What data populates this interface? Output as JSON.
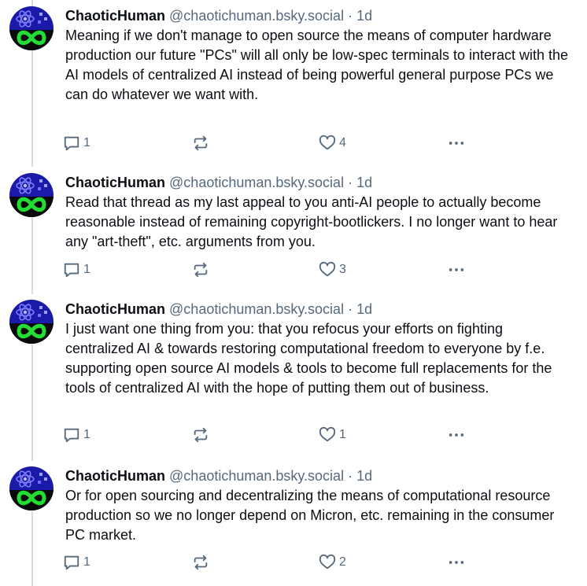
{
  "theme": {
    "text": "#0b0f14",
    "muted": "#56697c",
    "thread_line": "#d4dbe2",
    "avatar_bg": "#1a1aa8",
    "avatar_accent": "#22dd33"
  },
  "posts": [
    {
      "author": "ChaoticHuman",
      "handle": "@chaotichuman.bsky.social",
      "separator": "·",
      "time": "1d",
      "text": "Meaning if we don't manage to open source the means of computer hardware production our future \"PCs\" will all only be low-spec terminals to interact with the AI models of centralized AI instead of being powerful general purpose PCs we can do whatever we want with.",
      "replies": "1",
      "reposts": "",
      "likes": "4",
      "icons": [
        "reply-icon",
        "repost-icon",
        "heart-icon",
        "more-icon"
      ]
    },
    {
      "author": "ChaoticHuman",
      "handle": "@chaotichuman.bsky.social",
      "separator": "·",
      "time": "1d",
      "text": "Read that thread as my last appeal to you anti-AI people to actually become reasonable instead of remaining copyright-bootlickers. I no longer want to hear any \"art-theft\", etc. arguments from you.",
      "replies": "1",
      "reposts": "",
      "likes": "3",
      "icons": [
        "reply-icon",
        "repost-icon",
        "heart-icon",
        "more-icon"
      ]
    },
    {
      "author": "ChaoticHuman",
      "handle": "@chaotichuman.bsky.social",
      "separator": "·",
      "time": "1d",
      "text": "I just want one thing from you: that you refocus your efforts on fighting centralized AI & towards restoring computational freedom to everyone by f.e. supporting open source AI models & tools to become full replacements for the tools of centralized AI with the hope of putting them out of business.",
      "replies": "1",
      "reposts": "",
      "likes": "1",
      "icons": [
        "reply-icon",
        "repost-icon",
        "heart-icon",
        "more-icon"
      ]
    },
    {
      "author": "ChaoticHuman",
      "handle": "@chaotichuman.bsky.social",
      "separator": "·",
      "time": "1d",
      "text": "Or for open sourcing and decentralizing the means of computational resource production so we no longer depend on Micron, etc. remaining in the consumer PC market.",
      "replies": "1",
      "reposts": "",
      "likes": "2",
      "icons": [
        "reply-icon",
        "repost-icon",
        "heart-icon",
        "more-icon"
      ]
    }
  ]
}
